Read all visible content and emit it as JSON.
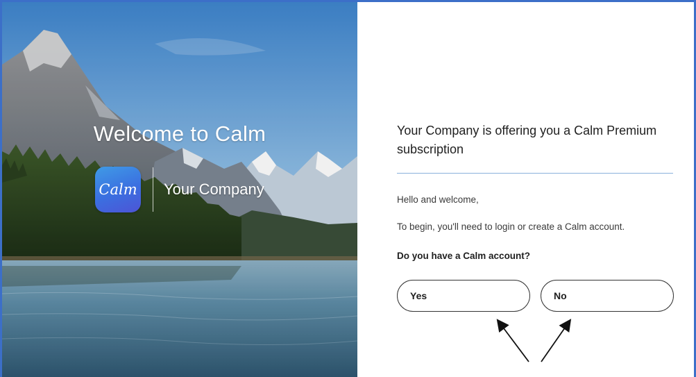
{
  "hero": {
    "welcome_title": "Welcome to Calm",
    "app_icon_text": "Calm",
    "company_name": "Your Company"
  },
  "panel": {
    "headline": "Your Company is offering you a Calm Premium subscription",
    "greeting": "Hello and welcome,",
    "instruction": "To begin, you'll need to login or create a Calm account.",
    "question": "Do you have a Calm account?",
    "yes_label": "Yes",
    "no_label": "No"
  },
  "colors": {
    "frame_border": "#3c6fc8",
    "divider_rule": "#8ab0dc",
    "app_icon_gradient": [
      "#3f9be6",
      "#4d54d6"
    ]
  },
  "icons": [
    "calm-app-icon",
    "annotation-arrow-yes",
    "annotation-arrow-no"
  ]
}
